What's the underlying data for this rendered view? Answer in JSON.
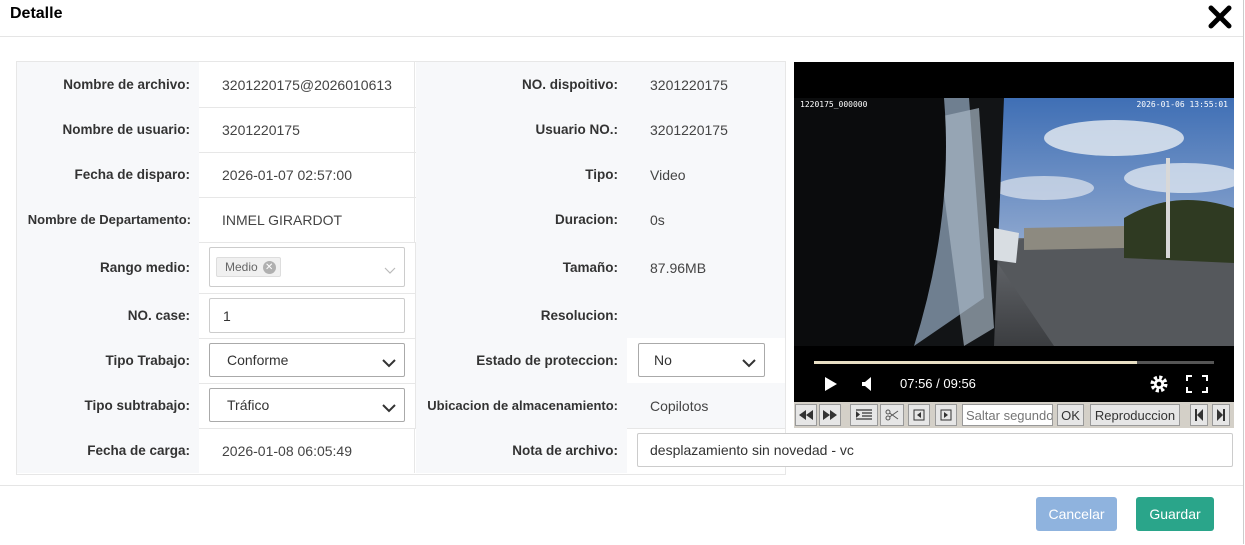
{
  "dialog": {
    "title": "Detalle"
  },
  "fields": {
    "filename": {
      "label": "Nombre de archivo:",
      "value": "3201220175@2026010613"
    },
    "device_no": {
      "label": "NO. dispoitivo:",
      "value": "3201220175"
    },
    "username": {
      "label": "Nombre de usuario:",
      "value": "3201220175"
    },
    "user_no": {
      "label": "Usuario NO.:",
      "value": "3201220175"
    },
    "trigger_date": {
      "label": "Fecha de disparo:",
      "value": "2026-01-07 02:57:00"
    },
    "type": {
      "label": "Tipo:",
      "value": "Video"
    },
    "department": {
      "label": "Nombre de Departamento:",
      "value": "INMEL GIRARDOT"
    },
    "duration": {
      "label": "Duracion:",
      "value": "0s"
    },
    "range": {
      "label": "Rango medio:",
      "tag": "Medio"
    },
    "size": {
      "label": "Tamaño:",
      "value": "87.96MB"
    },
    "case_no": {
      "label": "NO. case:",
      "value": "1"
    },
    "resolution": {
      "label": "Resolucion:",
      "value": ""
    },
    "work_type": {
      "label": "Tipo Trabajo:",
      "value": "Conforme"
    },
    "protection": {
      "label": "Estado de proteccion:",
      "value": "No"
    },
    "subwork_type": {
      "label": "Tipo subtrabajo:",
      "value": "Tráfico"
    },
    "storage": {
      "label": "Ubicacion de almacenamiento:",
      "value": "Copilotos"
    },
    "upload_date": {
      "label": "Fecha de carga:",
      "value": "2026-01-08 06:05:49"
    },
    "note": {
      "label": "Nota de archivo:",
      "value": "desplazamiento sin novedad - vc"
    }
  },
  "video": {
    "osd_left": "1220175_000000",
    "osd_right": "2026-01-06 13:55:01",
    "time": "07:56 / 09:56",
    "progress": 0.808
  },
  "toolbar": {
    "seek_placeholder": "Saltar segundos",
    "ok_label": "OK",
    "playback_label": "Reproduccion"
  },
  "footer": {
    "cancel_label": "Cancelar",
    "save_label": "Guardar"
  },
  "colors": {
    "cancel": "#8fb3de",
    "save": "#2aa58a"
  }
}
